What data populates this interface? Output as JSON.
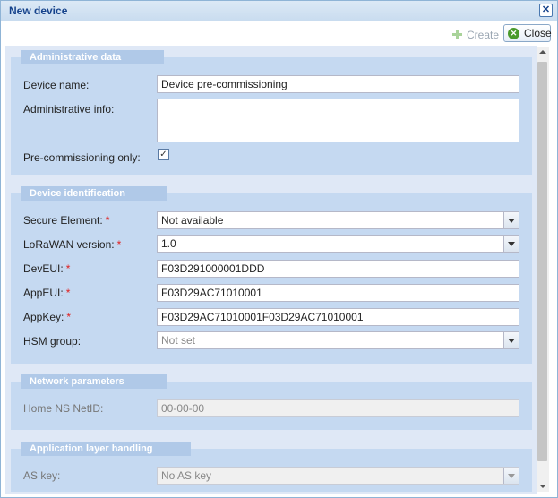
{
  "window": {
    "title": "New device",
    "close_glyph": "✕"
  },
  "toolbar": {
    "create_label": "Create",
    "close_label": "Close"
  },
  "sections": {
    "admin": {
      "legend": "Administrative data",
      "device_name_label": "Device name:",
      "device_name_value": "Device pre-commissioning",
      "admin_info_label": "Administrative info:",
      "admin_info_value": "",
      "precomm_label": "Pre-commissioning only:",
      "precomm_checked": true
    },
    "identification": {
      "legend": "Device identification",
      "secure_element_label": "Secure Element:",
      "secure_element_value": "Not available",
      "lorawan_label": "LoRaWAN version:",
      "lorawan_value": "1.0",
      "deveui_label": "DevEUI:",
      "deveui_value": "F03D291000001DDD",
      "appeui_label": "AppEUI:",
      "appeui_value": "F03D29AC71010001",
      "appkey_label": "AppKey:",
      "appkey_value": "F03D29AC71010001F03D29AC71010001",
      "hsm_label": "HSM group:",
      "hsm_value": "Not set"
    },
    "network": {
      "legend": "Network parameters",
      "home_ns_label": "Home NS NetID:",
      "home_ns_value": "00-00-00"
    },
    "application": {
      "legend": "Application layer handling",
      "as_key_label": "AS key:",
      "as_key_value": "No AS key"
    }
  },
  "required_mark": "*",
  "check_glyph": "✓",
  "colors": {
    "title": "#15428b",
    "panel": "#c5d9f1",
    "legend": "#b0c9e8",
    "required": "#e02020"
  }
}
